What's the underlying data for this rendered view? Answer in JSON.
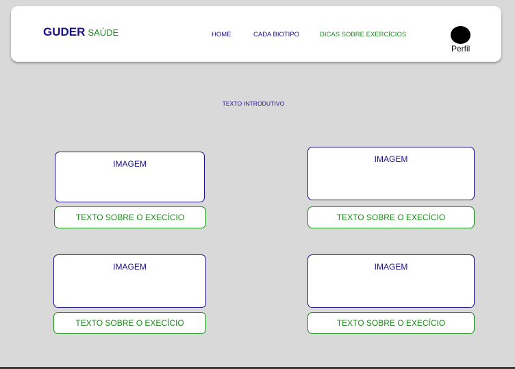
{
  "brand": {
    "main": "GUDER",
    "sub": "SAÚDE"
  },
  "nav": {
    "home": "HOME",
    "biotipo": "CADA BIOTIPO",
    "dicas": "DICAS SOBRE EXERCÍCIOS"
  },
  "profile": {
    "label": "Perfil"
  },
  "intro": {
    "text": "TEXTO  INTRODUTIVO"
  },
  "cards": [
    {
      "image_label": "IMAGEM",
      "text_label": "TEXTO SOBRE O EXECÍCIO"
    },
    {
      "image_label": "IMAGEM",
      "text_label": "TEXTO SOBRE O EXECÍCIO"
    },
    {
      "image_label": "IMAGEM",
      "text_label": "TEXTO SOBRE O EXECÍCIO"
    },
    {
      "image_label": "IMAGEM",
      "text_label": "TEXTO SOBRE O EXECÍCIO"
    }
  ],
  "colors": {
    "primary": "#1a0f8c",
    "accent": "#1a8c1a",
    "background": "#d9d9d9"
  }
}
